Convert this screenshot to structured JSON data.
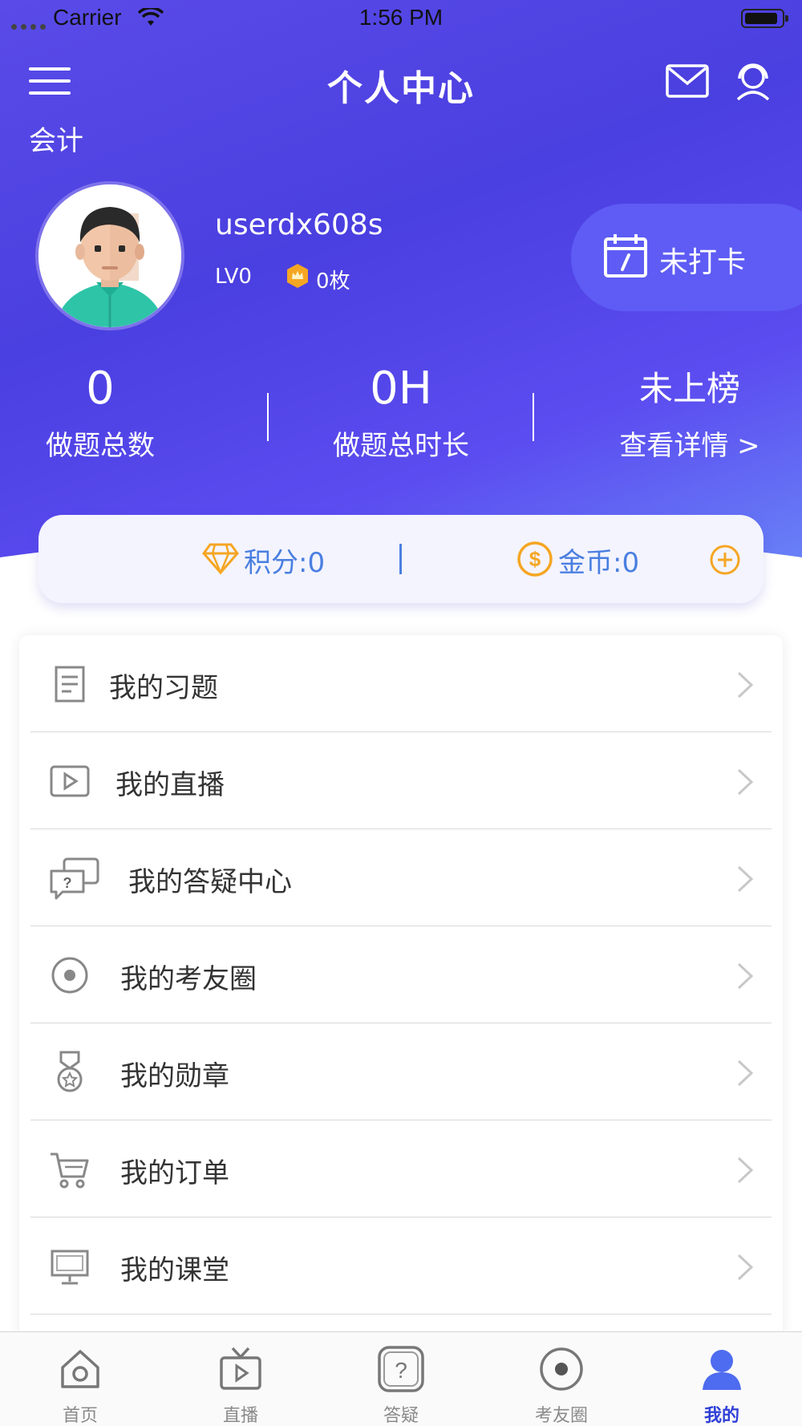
{
  "status_bar": {
    "carrier": "Carrier",
    "time": "1:56 PM"
  },
  "header": {
    "title": "个人中心",
    "subject": "会计"
  },
  "profile": {
    "username": "userdx608s",
    "level": "LV0",
    "medals": "0枚"
  },
  "checkin": {
    "label": "未打卡"
  },
  "stats": [
    {
      "value": "0",
      "label": "做题总数"
    },
    {
      "value": "0H",
      "label": "做题总时长"
    },
    {
      "value": "未上榜",
      "label": "查看详情 >"
    }
  ],
  "wallet": {
    "points": "积分:0",
    "coins": "金币:0"
  },
  "menu": [
    {
      "label": "我的习题",
      "icon": "document-icon"
    },
    {
      "label": "我的直播",
      "icon": "play-icon"
    },
    {
      "label": "我的答疑中心",
      "icon": "question-chat-icon"
    },
    {
      "label": "我的考友圈",
      "icon": "circle-dot-icon"
    },
    {
      "label": "我的勋章",
      "icon": "medal-icon"
    },
    {
      "label": "我的订单",
      "icon": "cart-icon"
    },
    {
      "label": "我的课堂",
      "icon": "classroom-icon"
    }
  ],
  "tabs": [
    {
      "label": "首页",
      "icon": "home-icon",
      "active": false
    },
    {
      "label": "直播",
      "icon": "tv-icon",
      "active": false
    },
    {
      "label": "答疑",
      "icon": "question-icon",
      "active": false
    },
    {
      "label": "考友圈",
      "icon": "circle-dot-icon",
      "active": false
    },
    {
      "label": "我的",
      "icon": "user-icon",
      "active": true
    }
  ],
  "colors": {
    "primary": "#4a3fe0",
    "accent_blue": "#4a7fe0",
    "accent_gold": "#f5a623",
    "active_tab": "#2f3fd6"
  }
}
